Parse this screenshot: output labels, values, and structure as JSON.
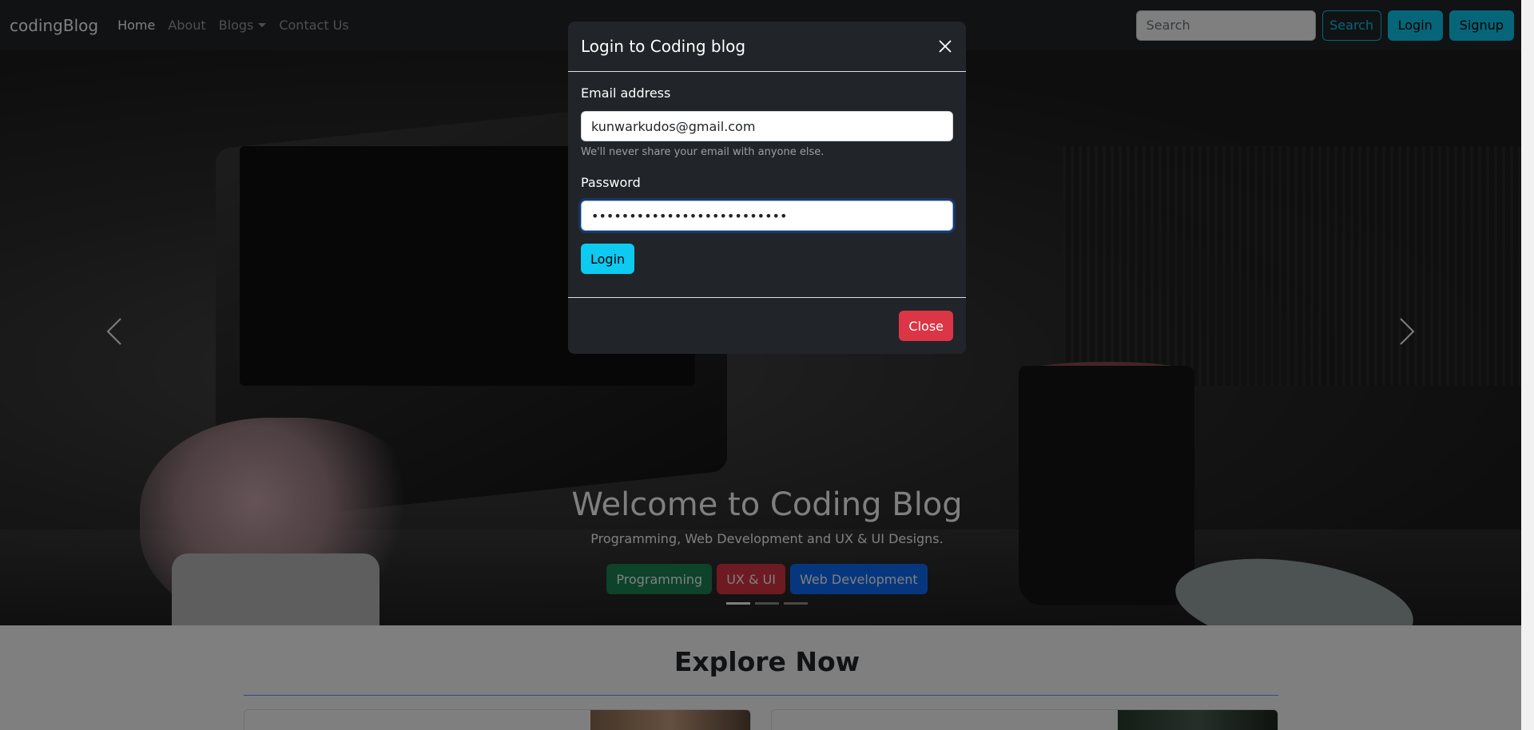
{
  "navbar": {
    "brand": "codingBlog",
    "links": [
      {
        "label": "Home"
      },
      {
        "label": "About"
      },
      {
        "label": "Blogs"
      },
      {
        "label": "Contact Us"
      }
    ],
    "search_placeholder": "Search",
    "search_button": "Search",
    "login_button": "Login",
    "signup_button": "Signup"
  },
  "hero": {
    "title": "Welcome to Coding Blog",
    "subtitle": "Programming, Web Development and UX & UI Designs.",
    "buttons": [
      "Programming",
      "UX & UI",
      "Web Development"
    ],
    "active_slide": 1,
    "slide_count": 3
  },
  "explore": {
    "title": "Explore Now"
  },
  "modal": {
    "title": "Login to Coding blog",
    "email_label": "Email address",
    "email_value": "kunwarkudos@gmail.com",
    "email_help": "We'll never share your email with anyone else.",
    "password_label": "Password",
    "password_value": "••••••••••••••••••••••••••",
    "submit_label": "Login",
    "close_label": "Close"
  },
  "colors": {
    "info": "#0dcaf0",
    "success": "#198754",
    "danger": "#dc3545",
    "primary": "#0d6efd",
    "dark": "#212529"
  }
}
